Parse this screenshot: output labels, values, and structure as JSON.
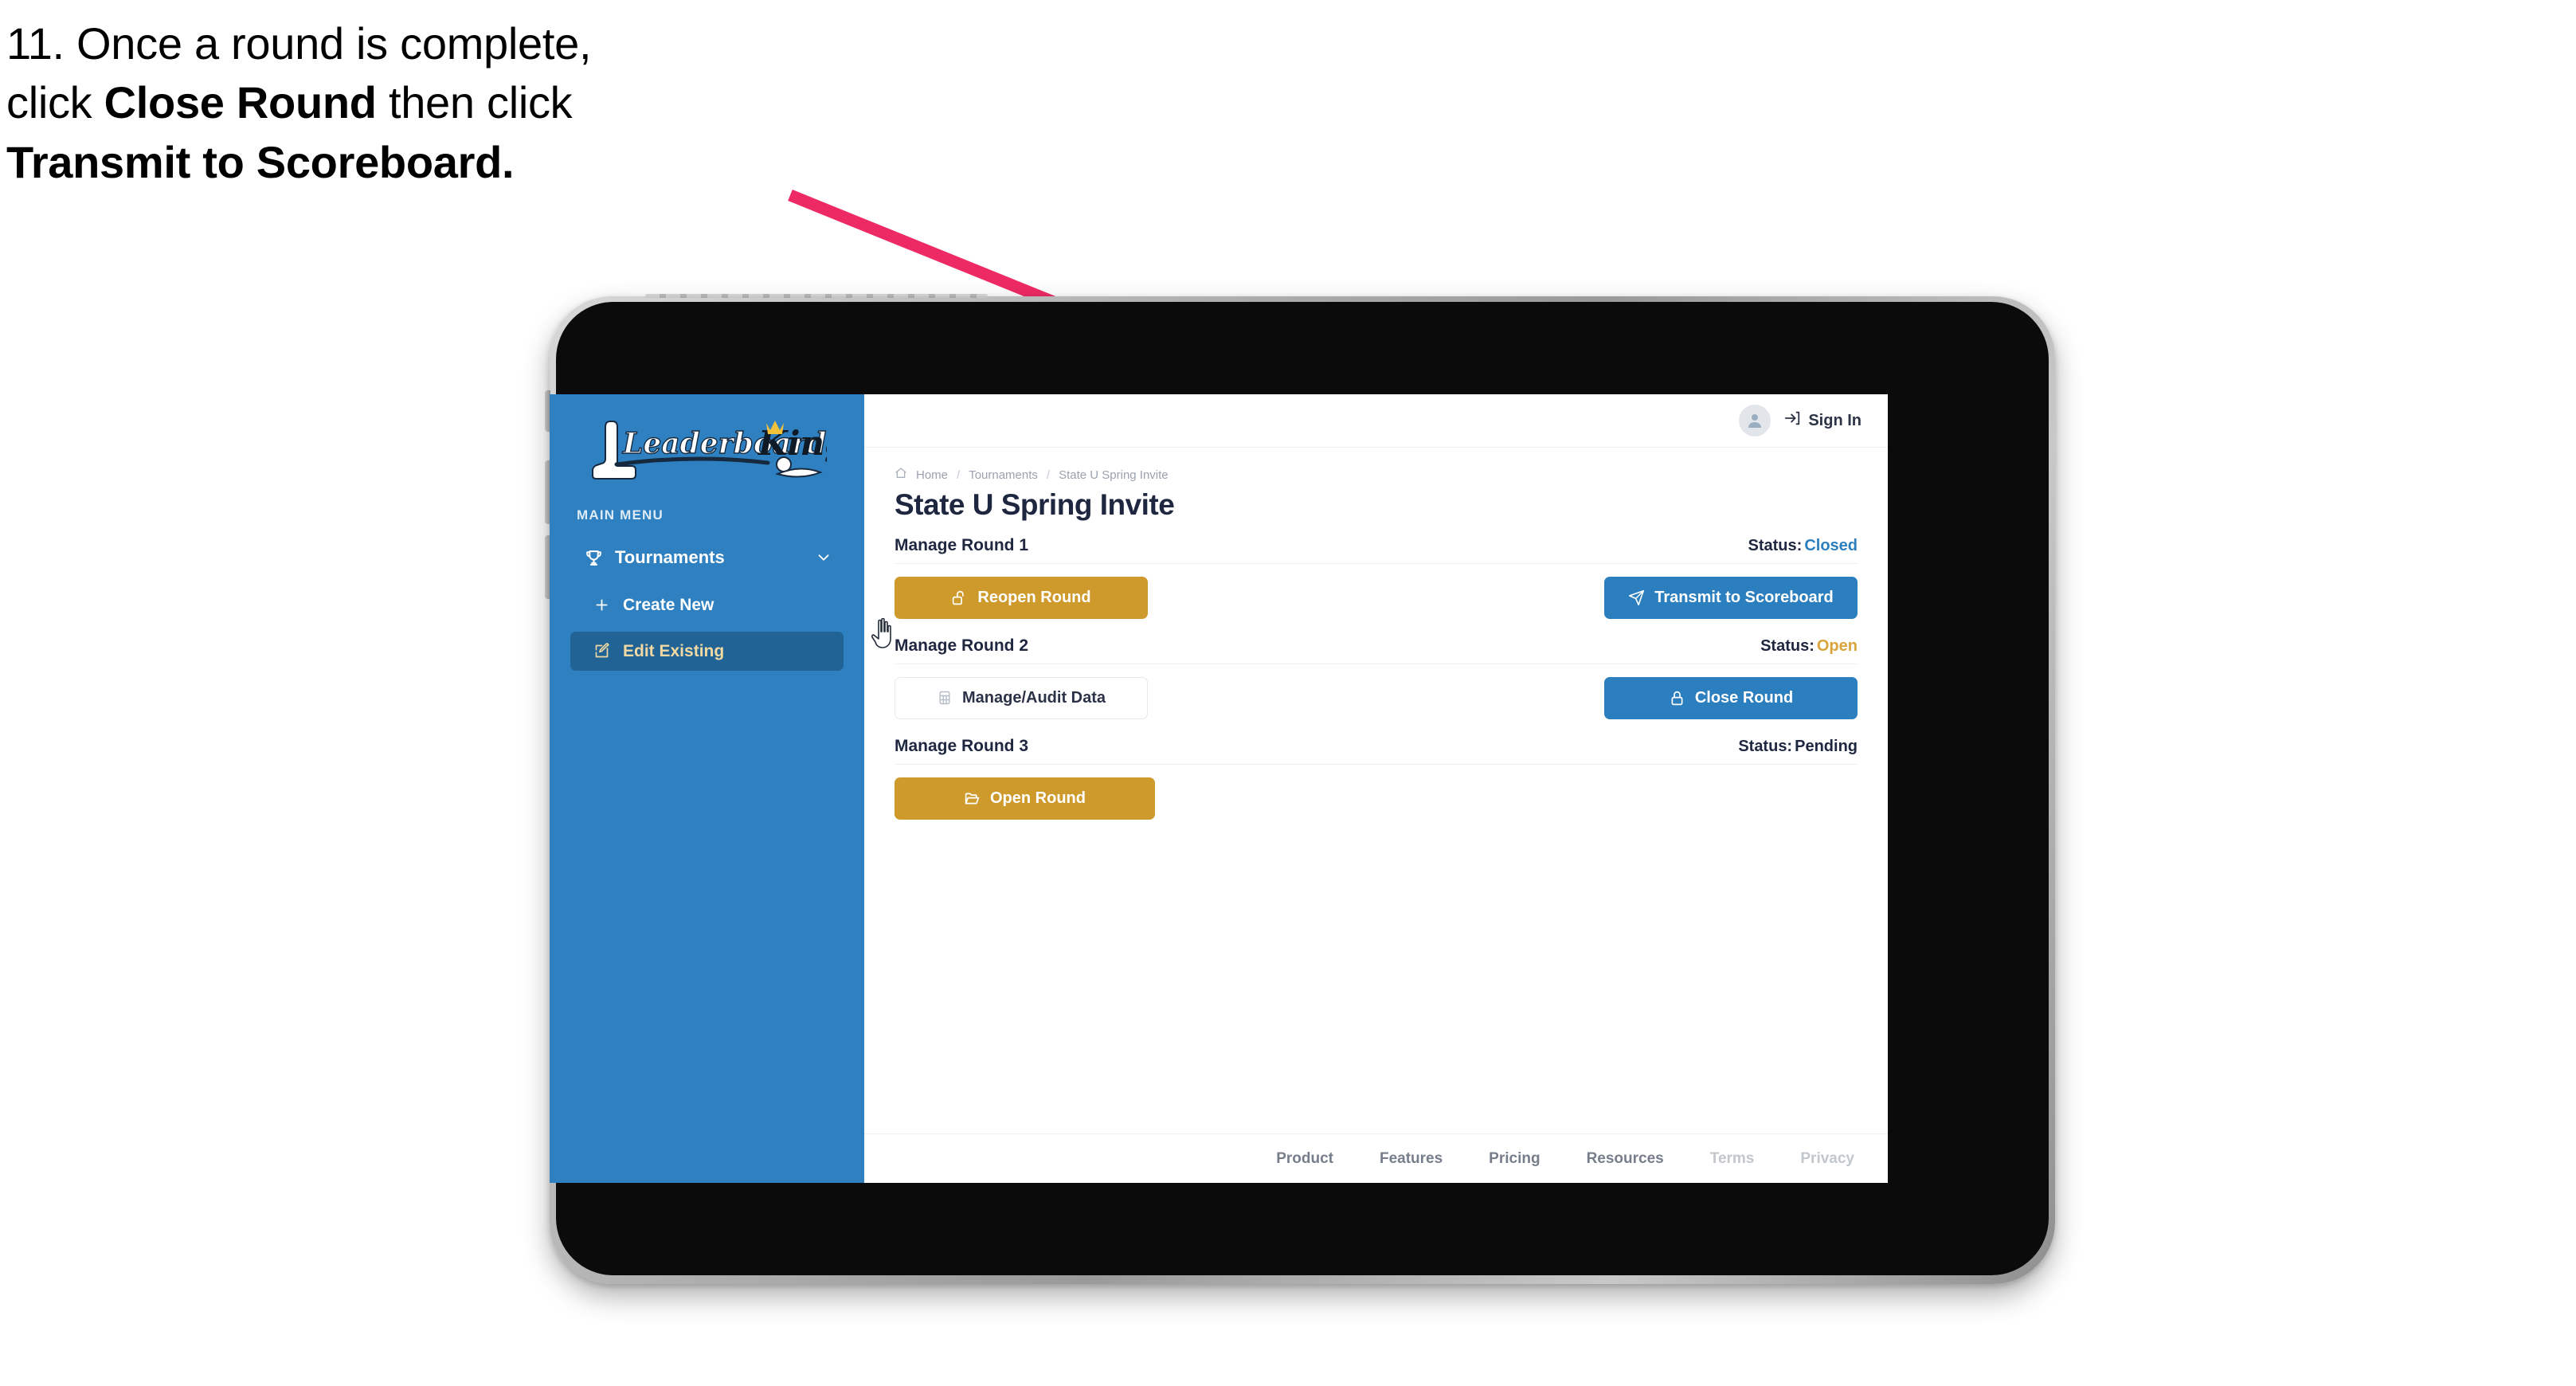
{
  "caption": {
    "line1": "11. Once a round is complete,",
    "line2_pre": "click ",
    "line2_bold": "Close Round",
    "line2_post": " then click",
    "line3_bold": "Transmit to Scoreboard."
  },
  "annotation": {
    "arrow_color": "#ee2a64"
  },
  "device": {
    "frame_color": "#b4b4b4",
    "bezel_color": "#0b0b0b"
  },
  "sidebar": {
    "brand": {
      "word1": "Leaderboard",
      "word2": "King",
      "bg": "#2e80c0"
    },
    "section_label": "MAIN MENU",
    "items": [
      {
        "label": "Tournaments",
        "icon": "trophy-icon",
        "expanded": true
      },
      {
        "label": "Create New",
        "icon": "plus-icon",
        "active": false
      },
      {
        "label": "Edit Existing",
        "icon": "edit-square-icon",
        "active": true
      }
    ],
    "active_text_color": "#f0d9a2",
    "active_bg_color": "#216395"
  },
  "topbar": {
    "avatar_icon": "user-avatar-icon",
    "signin_icon": "sign-in-arrow-icon",
    "signin_label": "Sign In"
  },
  "breadcrumb": {
    "home_icon": "home-icon",
    "items": [
      "Home",
      "Tournaments",
      "State U Spring Invite"
    ],
    "separator": "/"
  },
  "page": {
    "title": "State U Spring Invite"
  },
  "rounds": [
    {
      "title": "Manage Round 1",
      "status_label": "Status:",
      "status_value": "Closed",
      "status_color": "#2c7fbe",
      "left_button": {
        "label": "Reopen Round",
        "icon": "unlock-icon",
        "style": "gold"
      },
      "right_button": {
        "label": "Transmit to Scoreboard",
        "icon": "paper-plane-icon",
        "style": "blue"
      }
    },
    {
      "title": "Manage Round 2",
      "status_label": "Status:",
      "status_value": "Open",
      "status_color": "#d9a43a",
      "left_button": {
        "label": "Manage/Audit Data",
        "icon": "table-grid-icon",
        "style": "ghost"
      },
      "right_button": {
        "label": "Close Round",
        "icon": "lock-icon",
        "style": "blue"
      }
    },
    {
      "title": "Manage Round 3",
      "status_label": "Status:",
      "status_value": "Pending",
      "status_color": "#1f2740",
      "left_button": {
        "label": "Open Round",
        "icon": "folder-open-icon",
        "style": "gold"
      },
      "right_button": null
    }
  ],
  "footer": {
    "links": [
      {
        "label": "Product",
        "muted": false
      },
      {
        "label": "Features",
        "muted": false
      },
      {
        "label": "Pricing",
        "muted": false
      },
      {
        "label": "Resources",
        "muted": false
      },
      {
        "label": "Terms",
        "muted": true
      },
      {
        "label": "Privacy",
        "muted": true
      }
    ]
  },
  "cursor": {
    "type": "pointing-hand"
  }
}
